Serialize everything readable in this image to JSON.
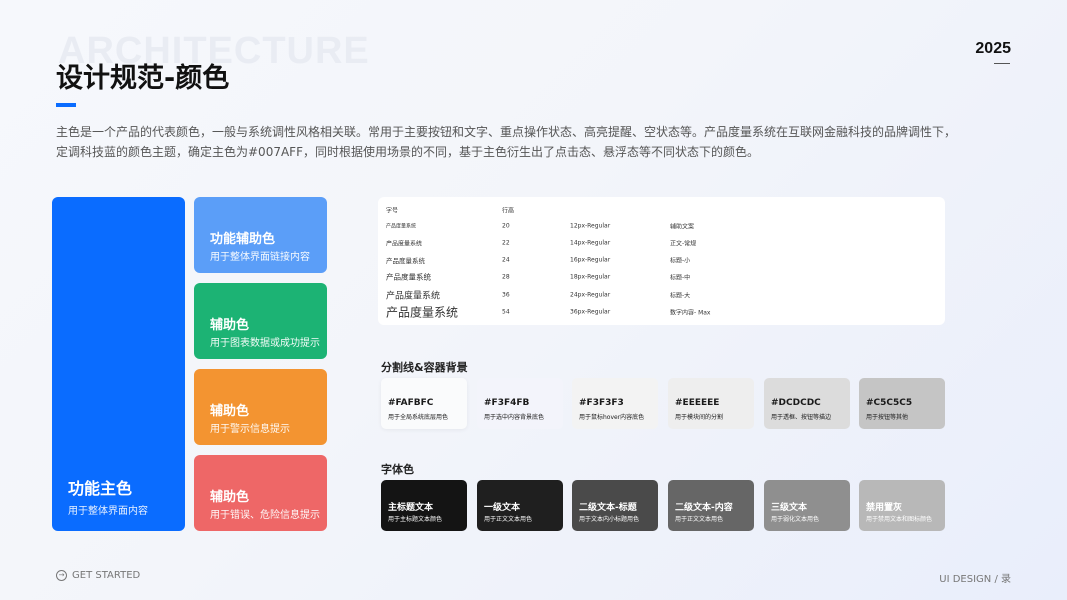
{
  "header": {
    "watermark": "ARCHITECTURE",
    "title": "设计规范-颜色",
    "year": "2025",
    "description": "主色是一个产品的代表颜色，一般与系统调性风格相关联。常用于主要按钮和文字、重点操作状态、高亮提醒、空状态等。产品度量系统在互联网金融科技的品牌调性下，定调科技蓝的颜色主题，确定主色为#007AFF，同时根据使用场景的不同，基于主色衍生出了点击态、悬浮态等不同状态下的颜色。"
  },
  "primary": {
    "title": "功能主色",
    "subtitle": "用于整体界面内容",
    "color": "#0A6CFF"
  },
  "aux": [
    {
      "title": "功能辅助色",
      "subtitle": "用于整体界面链接内容",
      "color": "#5B9EF8"
    },
    {
      "title": "辅助色",
      "subtitle": "用于图表数据或成功提示",
      "color": "#1CB374"
    },
    {
      "title": "辅助色",
      "subtitle": "用于警示信息提示",
      "color": "#F39431"
    },
    {
      "title": "辅助色",
      "subtitle": "用于错误、危险信息提示",
      "color": "#EE6767"
    }
  ],
  "typography": {
    "headers": {
      "font": "字号",
      "line_height": "行高"
    },
    "rows": [
      {
        "sample": "产品度量系统",
        "line_height": "20",
        "spec": "12px-Regular",
        "usage": "辅助文案"
      },
      {
        "sample": "产品度量系统",
        "line_height": "22",
        "spec": "14px-Regular",
        "usage": "正文-常规"
      },
      {
        "sample": "产品度量系统",
        "line_height": "24",
        "spec": "16px-Regular",
        "usage": "标题-小"
      },
      {
        "sample": "产品度量系统",
        "line_height": "28",
        "spec": "18px-Regular",
        "usage": "标题-中"
      },
      {
        "sample": "产品度量系统",
        "line_height": "36",
        "spec": "24px-Regular",
        "usage": "标题-大"
      },
      {
        "sample": "产品度量系统",
        "line_height": "54",
        "spec": "36px-Regular",
        "usage": "数字内容- Max"
      }
    ]
  },
  "divider_section": {
    "label": "分割线&容器背景",
    "swatches": [
      {
        "hex": "#FAFBFC",
        "desc": "用于全局系统底层用色",
        "color": "#FAFBFC"
      },
      {
        "hex": "#F3F4FB",
        "desc": "用于选中内容背景底色",
        "color": "#F3F4FB"
      },
      {
        "hex": "#F3F3F3",
        "desc": "用于鼠标hover内容底色",
        "color": "#F3F3F3"
      },
      {
        "hex": "#EEEEEE",
        "desc": "用于模块间的分割",
        "color": "#EEEEEE"
      },
      {
        "hex": "#DCDCDC",
        "desc": "用于透框、按钮等描边",
        "color": "#DCDCDC"
      },
      {
        "hex": "#C5C5C5",
        "desc": "用于按钮等其他",
        "color": "#C5C5C5"
      }
    ]
  },
  "text_section": {
    "label": "字体色",
    "swatches": [
      {
        "hex": "主标题文本",
        "desc": "用于主标题文本颜色",
        "color": "#141414"
      },
      {
        "hex": "一级文本",
        "desc": "用于正文文本用色",
        "color": "#1F1F1F"
      },
      {
        "hex": "二级文本-标题",
        "desc": "用于文本内小标题用色",
        "color": "#4A4A4A"
      },
      {
        "hex": "二级文本-内容",
        "desc": "用于正文文本用色",
        "color": "#666666"
      },
      {
        "hex": "三级文本",
        "desc": "用于弱化文本用色",
        "color": "#8F8F8F"
      },
      {
        "hex": "禁用置灰",
        "desc": "用于禁用文本和图标颜色",
        "color": "#B8B8B8"
      }
    ]
  },
  "footer": {
    "left": "GET STARTED",
    "right": "UI DESIGN / 录",
    "icon": "arrow-right-circle-icon"
  }
}
